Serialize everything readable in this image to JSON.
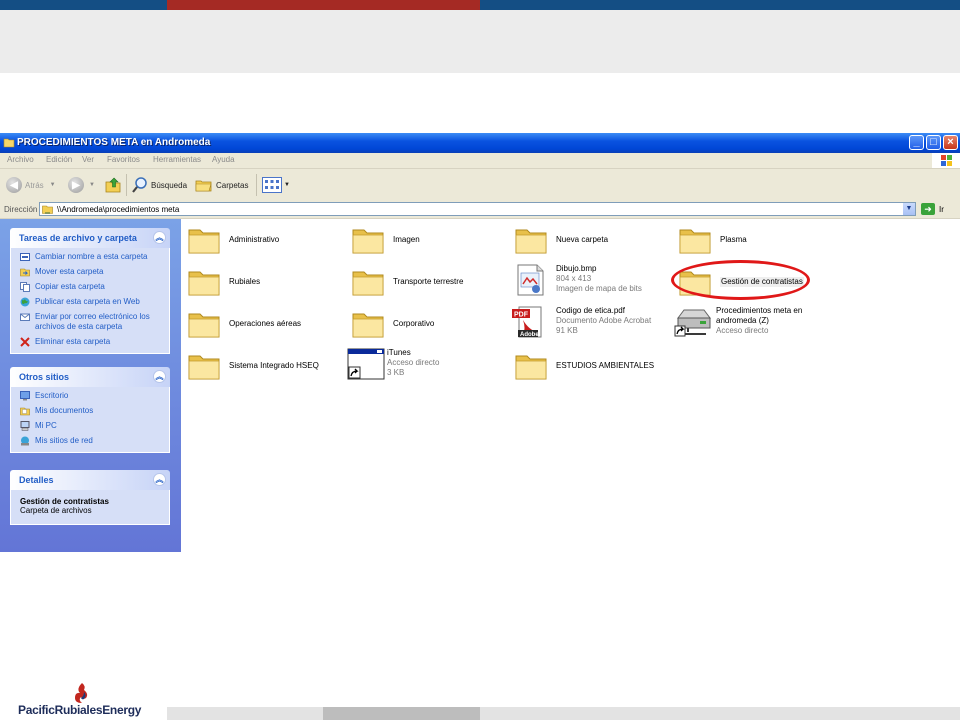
{
  "colors": {
    "topbar": [
      "#144e84",
      "#a52a24",
      "#144e84"
    ],
    "bottombar": [
      "#e3e3e3",
      "#bdbdbd",
      "#e3e3e3"
    ],
    "xp_blue": "#0a53e0",
    "task_link": "#215dc6",
    "highlight_ellipse": "#e01818"
  },
  "slide": {
    "logo": {
      "text_a": "PacificRubiales",
      "text_b": "Energy",
      "icon": "flame-logo-icon"
    }
  },
  "window": {
    "title": "PROCEDIMIENTOS META en Andromeda",
    "controls": {
      "minimize": "_",
      "maximize": "□",
      "close": "×"
    },
    "menu": [
      "Archivo",
      "Edición",
      "Ver",
      "Favoritos",
      "Herramientas",
      "Ayuda"
    ],
    "toolbar": {
      "back": "Atrás",
      "search": "Búsqueda",
      "folders": "Carpetas"
    },
    "address": {
      "label": "Dirección",
      "value": "\\\\Andromeda\\procedimientos meta",
      "go": "Ir"
    }
  },
  "left_pane": {
    "tasks": {
      "title": "Tareas de archivo y carpeta",
      "items": [
        {
          "label": "Cambiar nombre a esta carpeta",
          "icon": "rename-icon"
        },
        {
          "label": "Mover esta carpeta",
          "icon": "move-icon"
        },
        {
          "label": "Copiar esta carpeta",
          "icon": "copy-icon"
        },
        {
          "label": "Publicar esta carpeta en Web",
          "icon": "web-publish-icon"
        },
        {
          "label": "Enviar por correo electrónico los archivos de esta carpeta",
          "icon": "email-icon"
        },
        {
          "label": "Eliminar esta carpeta",
          "icon": "delete-icon"
        }
      ]
    },
    "other_places": {
      "title": "Otros sitios",
      "items": [
        {
          "label": "Escritorio",
          "icon": "desktop-icon"
        },
        {
          "label": "Mis documentos",
          "icon": "my-documents-icon"
        },
        {
          "label": "Mi PC",
          "icon": "my-computer-icon"
        },
        {
          "label": "Mis sitios de red",
          "icon": "network-places-icon"
        }
      ]
    },
    "details": {
      "title": "Detalles",
      "name": "Gestión de contratistas",
      "type": "Carpeta de archivos"
    }
  },
  "items": [
    {
      "name": "Administrativo",
      "kind": "folder"
    },
    {
      "name": "Imagen",
      "kind": "folder"
    },
    {
      "name": "Nueva carpeta",
      "kind": "folder"
    },
    {
      "name": "Plasma",
      "kind": "folder"
    },
    {
      "name": "Rubiales",
      "kind": "folder"
    },
    {
      "name": "Transporte terrestre",
      "kind": "folder"
    },
    {
      "name": "Dibujo.bmp",
      "kind": "bmp",
      "meta1": "804 x 413",
      "meta2": "Imagen de mapa de bits"
    },
    {
      "name": "Gestión de contratistas",
      "kind": "folder",
      "highlighted": true
    },
    {
      "name": "Operaciones aéreas",
      "kind": "folder"
    },
    {
      "name": "Corporativo",
      "kind": "folder"
    },
    {
      "name": "Codigo de etica.pdf",
      "kind": "pdf",
      "meta1": "Documento Adobe Acrobat",
      "meta2": "91 KB"
    },
    {
      "name": "Procedimientos meta en",
      "name2": "andromeda (Z)",
      "kind": "drive",
      "meta1": "Acceso directo"
    },
    {
      "name": "Sistema Integrado HSEQ",
      "kind": "folder"
    },
    {
      "name": "iTunes",
      "kind": "shortcut",
      "meta1": "Acceso directo",
      "meta2": "3 KB"
    },
    {
      "name": "ESTUDIOS AMBIENTALES",
      "kind": "folder"
    }
  ]
}
